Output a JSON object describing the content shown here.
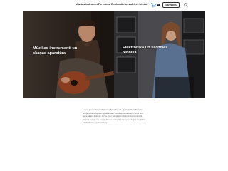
{
  "nav": {
    "items": [
      "Mūzikas instrumenti",
      "Par mums",
      "Elektronika un sadzīves tehnika"
    ],
    "cart_count": "0",
    "contact_label": "Sazināties"
  },
  "hero": {
    "left_title": "Mūzikas instrumenti un skaņas aparatūra",
    "right_title": "Elektronika un sadzīves tehnika"
  },
  "body": {
    "text": "Lorem ipsum dolor, sit amet adipisicing elit. Quas quidem illum ex temporibus voluptate repudiandae. Consequuntur enim minus non, quos, ullam dolorum facilis illum voluptatem deleniti ducimus velit minima numquam rerum dolores corrupti accusamus fugiat illo. Dicta pariatur esse, quam labore."
  },
  "colors": {
    "accent": "#1f6fd1",
    "hero_left": "#2b2420",
    "hero_right": "#3a3a3c"
  }
}
